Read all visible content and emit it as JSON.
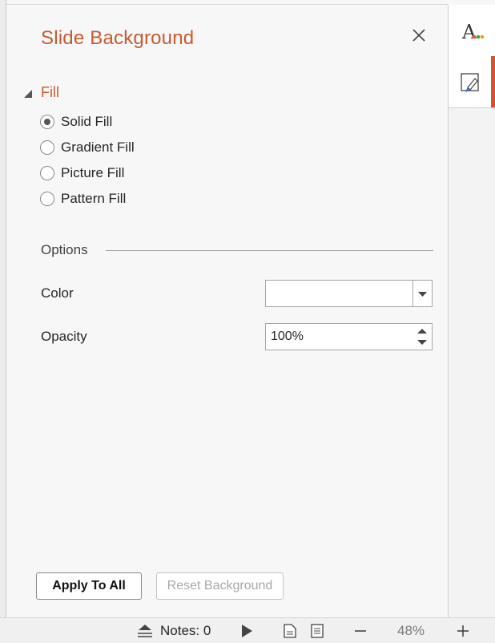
{
  "pane": {
    "title": "Slide Background",
    "close_icon": "close-icon"
  },
  "fill": {
    "section_label": "Fill",
    "options": [
      {
        "label": "Solid Fill",
        "selected": true
      },
      {
        "label": "Gradient Fill",
        "selected": false
      },
      {
        "label": "Picture Fill",
        "selected": false
      },
      {
        "label": "Pattern Fill",
        "selected": false
      }
    ]
  },
  "options": {
    "section_label": "Options",
    "color_label": "Color",
    "color_value": "#ffffff",
    "opacity_label": "Opacity",
    "opacity_value": "100%"
  },
  "buttons": {
    "apply_to_all": "Apply To All",
    "reset_background": "Reset Background"
  },
  "side_tabs": [
    {
      "icon": "font-color-icon",
      "active": false
    },
    {
      "icon": "slide-background-icon",
      "active": true
    }
  ],
  "status_bar": {
    "notes_label": "Notes: 0",
    "zoom_level": "48%"
  },
  "colors": {
    "accent": "#c75b2e",
    "active_tab": "#d35230",
    "panel_bg": "#f7f7f7"
  }
}
